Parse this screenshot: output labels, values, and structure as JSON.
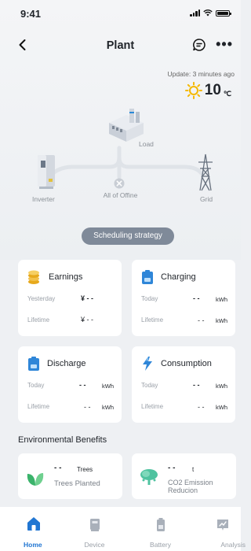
{
  "status_bar": {
    "time": "9:41"
  },
  "header": {
    "title": "Plant"
  },
  "update_text": "Update: 3 minutes ago",
  "weather": {
    "temperature": "10",
    "unit": "℃"
  },
  "flow": {
    "load_label": "Load",
    "inverter_label": "Inverter",
    "grid_label": "Grid",
    "center_label": "All of Offine"
  },
  "scheduling_button": "Scheduling strategy",
  "cards": {
    "earnings": {
      "title": "Earnings",
      "row1_label": "Yesterday",
      "row1_value": "¥ - -",
      "row2_label": "Lifetime",
      "row2_value": "¥ - -"
    },
    "charging": {
      "title": "Charging",
      "row1_label": "Today",
      "row1_value": "- -",
      "row1_unit": "kWh",
      "row2_label": "Lifetime",
      "row2_value": "- -",
      "row2_unit": "kWh"
    },
    "discharge": {
      "title": "Discharge",
      "row1_label": "Today",
      "row1_value": "- -",
      "row1_unit": "kWh",
      "row2_label": "Lifetime",
      "row2_value": "- -",
      "row2_unit": "kWh"
    },
    "consumption": {
      "title": "Consumption",
      "row1_label": "Today",
      "row1_value": "- -",
      "row1_unit": "kWh",
      "row2_label": "Lifetime",
      "row2_value": "- -",
      "row2_unit": "kWh"
    }
  },
  "environmental": {
    "title": "Environmental Benefits",
    "trees": {
      "value": "- -",
      "unit": "Trees",
      "label": "Trees Planted"
    },
    "co2": {
      "value": "- -",
      "unit": "t",
      "label": "CO2 Emission Reducion"
    }
  },
  "tabs": [
    {
      "label": "Home"
    },
    {
      "label": "Device"
    },
    {
      "label": "Battery"
    },
    {
      "label": "Analysis"
    }
  ],
  "colors": {
    "accent": "#2176d2",
    "button_bg": "#7f8a99",
    "sun": "#f5b800",
    "leaf": "#3bb36b"
  },
  "icons": {
    "back": "chevron-left-icon",
    "chat": "chat-icon",
    "more": "more-icon",
    "sun": "sun-icon",
    "earnings": "coins-icon",
    "charging": "battery-charge-icon",
    "discharge": "battery-discharge-icon",
    "consumption": "lightning-icon",
    "trees": "leaf-icon",
    "co2": "tree-icon",
    "home": "home-icon",
    "device": "device-icon",
    "battery": "battery-icon",
    "analysis": "chart-icon"
  }
}
